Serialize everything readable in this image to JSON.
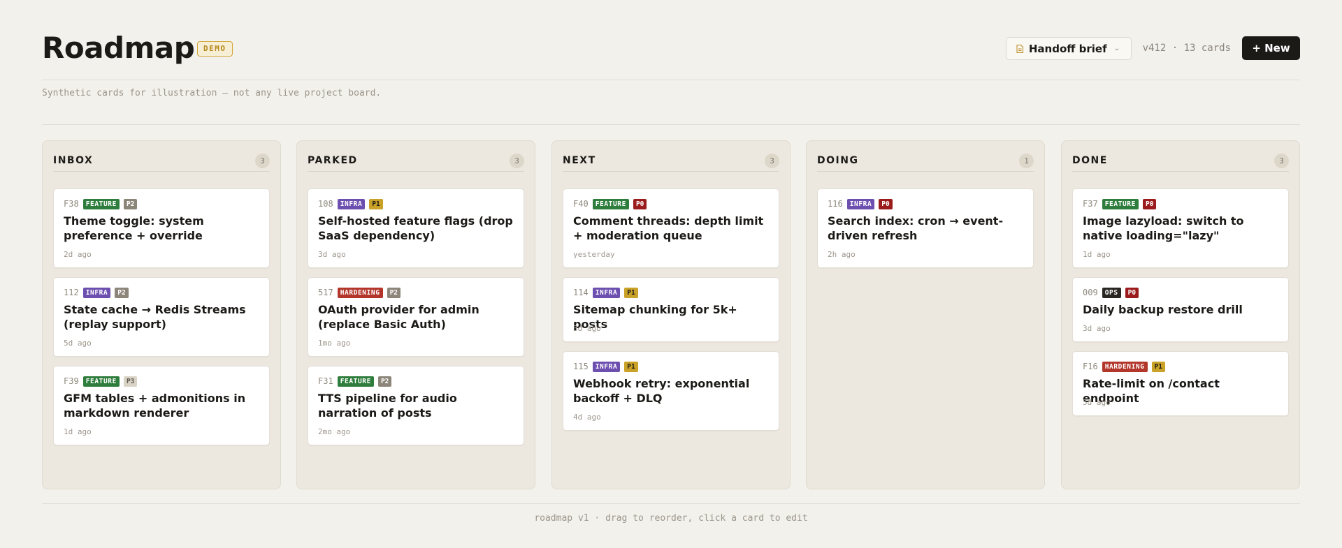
{
  "header": {
    "title": "Roadmap",
    "badge": "DEMO",
    "handoff_label": "Handoff brief",
    "version": "v412 · 13 cards",
    "new_label": "+ New"
  },
  "subtitle": "Synthetic cards for illustration — not any live project board.",
  "footer": "roadmap v1 · drag to reorder, click a card to edit",
  "colors": {
    "FEATURE": "#2e7d3c",
    "INFRA": "#6d4fb0",
    "HARDENING": "#b3362b",
    "OPS": "#2a2723",
    "P0": {
      "bg": "#9b1c1c",
      "fg": "#ffffff"
    },
    "P1": {
      "bg": "#c9a227",
      "fg": "#1c1a17"
    },
    "P2": {
      "bg": "#8c8579",
      "fg": "#ffffff"
    },
    "P3": {
      "bg": "#d9d3c6",
      "fg": "#5e584e"
    }
  },
  "columns": [
    {
      "title": "INBOX",
      "count": "3",
      "cards": [
        {
          "id": "F38",
          "tag": "FEATURE",
          "priority": "P2",
          "title": "Theme toggle: system preference + override",
          "time": "2d ago"
        },
        {
          "id": "112",
          "tag": "INFRA",
          "priority": "P2",
          "title": "State cache → Redis Streams (replay support)",
          "time": "5d ago"
        },
        {
          "id": "F39",
          "tag": "FEATURE",
          "priority": "P3",
          "title": "GFM tables + admonitions in markdown renderer",
          "time": "1d ago"
        }
      ]
    },
    {
      "title": "PARKED",
      "count": "3",
      "cards": [
        {
          "id": "108",
          "tag": "INFRA",
          "priority": "P1",
          "title": "Self-hosted feature flags (drop SaaS dependency)",
          "time": "3d ago"
        },
        {
          "id": "517",
          "tag": "HARDENING",
          "priority": "P2",
          "title": "OAuth provider for admin (replace Basic Auth)",
          "time": "1mo ago"
        },
        {
          "id": "F31",
          "tag": "FEATURE",
          "priority": "P2",
          "title": "TTS pipeline for audio narration of posts",
          "time": "2mo ago"
        }
      ]
    },
    {
      "title": "NEXT",
      "count": "3",
      "cards": [
        {
          "id": "F40",
          "tag": "FEATURE",
          "priority": "P0",
          "title": "Comment threads: depth limit + moderation queue",
          "time": "yesterday"
        },
        {
          "id": "114",
          "tag": "INFRA",
          "priority": "P1",
          "title": "Sitemap chunking for 5k+ posts",
          "time": "3d ago"
        },
        {
          "id": "115",
          "tag": "INFRA",
          "priority": "P1",
          "title": "Webhook retry: exponential backoff + DLQ",
          "time": "4d ago"
        }
      ]
    },
    {
      "title": "DOING",
      "count": "1",
      "cards": [
        {
          "id": "116",
          "tag": "INFRA",
          "priority": "P0",
          "title": "Search index: cron → event-driven refresh",
          "time": "2h ago"
        }
      ]
    },
    {
      "title": "DONE",
      "count": "3",
      "cards": [
        {
          "id": "F37",
          "tag": "FEATURE",
          "priority": "P0",
          "title": "Image lazyload: switch to native loading=\"lazy\"",
          "time": "1d ago"
        },
        {
          "id": "009",
          "tag": "OPS",
          "priority": "P0",
          "title": "Daily backup restore drill",
          "time": "3d ago"
        },
        {
          "id": "F16",
          "tag": "HARDENING",
          "priority": "P1",
          "title": "Rate-limit on /contact endpoint",
          "time": "5d ago"
        }
      ]
    }
  ]
}
